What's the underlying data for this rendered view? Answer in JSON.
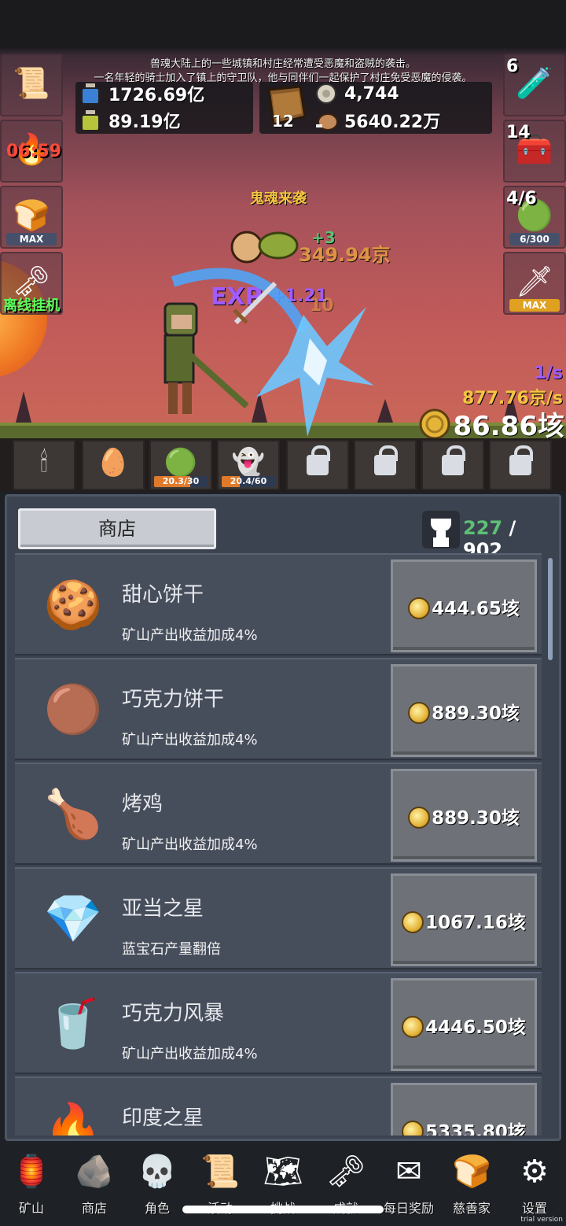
{
  "story": {
    "line1": "兽魂大陆上的一些城镇和村庄经常遭受恶魔和盗贼的袭击。",
    "line2": "一名年轻的骑士加入了镇上的守卫队，他与同伴们一起保护了村庄免受恶魔的侵袭。"
  },
  "resources": {
    "blue_potion": "1726.69亿",
    "green_potion": "89.19亿",
    "book_count": "12",
    "coin_small": "4,744",
    "meat": "5640.22万"
  },
  "left_buttons": {
    "scroll_icon": "scroll-icon",
    "torch_timer": "06:59",
    "bread_badge": "MAX",
    "offline_label": "离线挂机"
  },
  "right_buttons": {
    "potion_count": "6",
    "chest_count": "14",
    "slime_count": "4/6",
    "slime_progress": "6/300",
    "sword_badge": "MAX"
  },
  "battle": {
    "event": "鬼魂来袭",
    "drop": "+3",
    "drop_value": "349.94京",
    "exp_label": "EXP",
    "exp_value": "+1.21",
    "faded_value": "10",
    "rate_exp": "1/s",
    "rate_coin": "877.76京/s",
    "total_coin": "86.86垓"
  },
  "strip": [
    {
      "icon": "candle-icon"
    },
    {
      "icon": "egg-icon"
    },
    {
      "icon": "slime-icon",
      "progress": "20.3/30",
      "fill": 0.68
    },
    {
      "icon": "ghost-icon",
      "progress": "20.4/60",
      "fill": 0.34
    },
    {
      "icon": "lock-icon"
    },
    {
      "icon": "lock-icon"
    },
    {
      "icon": "lock-icon"
    },
    {
      "icon": "lock-icon"
    }
  ],
  "shop": {
    "tab_label": "商店",
    "trophy_current": "227",
    "trophy_sep": " / ",
    "trophy_total": "902",
    "items": [
      {
        "name": "甜心饼干",
        "desc": "矿山产出收益加成4%",
        "price": "444.65垓",
        "icon": "heart-cookie-icon"
      },
      {
        "name": "巧克力饼干",
        "desc": "矿山产出收益加成4%",
        "price": "889.30垓",
        "icon": "chocolate-cookie-icon"
      },
      {
        "name": "烤鸡",
        "desc": "矿山产出收益加成4%",
        "price": "889.30垓",
        "icon": "roast-chicken-icon"
      },
      {
        "name": "亚当之星",
        "desc": "蓝宝石产量翻倍",
        "price": "1067.16垓",
        "icon": "adam-star-icon"
      },
      {
        "name": "巧克力风暴",
        "desc": "矿山产出收益加成4%",
        "price": "4446.50垓",
        "icon": "chocolate-storm-icon"
      },
      {
        "name": "印度之星",
        "desc": "",
        "price": "5335.80垓",
        "icon": "india-star-icon"
      }
    ]
  },
  "nav": [
    {
      "label": "矿山",
      "icon": "lantern-icon"
    },
    {
      "label": "商店",
      "icon": "stone-icon"
    },
    {
      "label": "角色",
      "icon": "skull-icon"
    },
    {
      "label": "活动",
      "icon": "scroll-icon"
    },
    {
      "label": "挑战",
      "icon": "map-icon"
    },
    {
      "label": "成就",
      "icon": "key-icon"
    },
    {
      "label": "每日奖励",
      "icon": "letter-icon"
    },
    {
      "label": "慈善家",
      "icon": "bread-icon"
    },
    {
      "label": "设置",
      "icon": "gear-icon"
    }
  ],
  "trial_text": "trial version",
  "colors": {
    "coin": "#e5b53b",
    "exp": "#a05cff",
    "rate": "#f5c542",
    "timer": "#ff4a3a",
    "offline": "#5cff5c"
  }
}
